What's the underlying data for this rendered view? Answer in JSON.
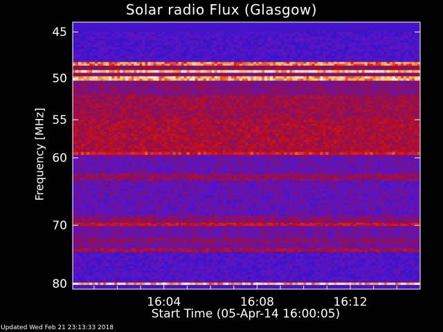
{
  "chart_data": {
    "type": "heatmap",
    "title": "Solar radio Flux (Glasgow)",
    "xlabel": "Start Time (05-Apr-14 16:00:05)",
    "ylabel": "Frequency [MHz]",
    "x_ticks": [
      "16:04",
      "16:08",
      "16:12"
    ],
    "y_ticks": [
      "45",
      "50",
      "55",
      "60",
      "70",
      "80"
    ],
    "x_tick_times": [
      "16:04",
      "16:08",
      "16:12"
    ],
    "y_tick_values": [
      45,
      50,
      55,
      60,
      70,
      80
    ],
    "y_scale": "log",
    "ylim": [
      44,
      81
    ],
    "xlim": [
      "16:00:05",
      "16:15:00"
    ],
    "colormap": "blue-red-yellow-white",
    "frequency_bands_mhz": [
      {
        "from": 45.0,
        "to": 48.2,
        "level": 0.18
      },
      {
        "from": 48.2,
        "to": 48.6,
        "level": 0.85
      },
      {
        "from": 48.6,
        "to": 49.1,
        "level": 0.45
      },
      {
        "from": 49.1,
        "to": 49.4,
        "level": 0.92
      },
      {
        "from": 49.4,
        "to": 49.8,
        "level": 0.4
      },
      {
        "from": 49.8,
        "to": 50.3,
        "level": 0.9
      },
      {
        "from": 50.3,
        "to": 52.0,
        "level": 0.4
      },
      {
        "from": 52.0,
        "to": 55.0,
        "level": 0.5
      },
      {
        "from": 55.0,
        "to": 59.2,
        "level": 0.55
      },
      {
        "from": 59.2,
        "to": 59.6,
        "level": 0.7
      },
      {
        "from": 59.6,
        "to": 62.2,
        "level": 0.3
      },
      {
        "from": 62.2,
        "to": 63.2,
        "level": 0.45
      },
      {
        "from": 63.2,
        "to": 68.5,
        "level": 0.28
      },
      {
        "from": 68.5,
        "to": 69.6,
        "level": 0.42
      },
      {
        "from": 69.6,
        "to": 70.1,
        "level": 0.65
      },
      {
        "from": 70.1,
        "to": 72.0,
        "level": 0.32
      },
      {
        "from": 72.0,
        "to": 73.0,
        "level": 0.42
      },
      {
        "from": 73.0,
        "to": 73.8,
        "level": 0.32
      },
      {
        "from": 73.8,
        "to": 74.4,
        "level": 0.55
      },
      {
        "from": 74.4,
        "to": 79.8,
        "level": 0.2
      },
      {
        "from": 79.8,
        "to": 80.2,
        "level": 0.9
      }
    ],
    "palette": {
      "background": "#000000",
      "axis": "#ffffff",
      "low": "#2a1ad0",
      "mid": "#a3103f",
      "high": "#e82010",
      "peak": "#f6c8a0"
    }
  },
  "footer": {
    "updated": "Updated Wed Feb 21 23:13:33 2018"
  }
}
